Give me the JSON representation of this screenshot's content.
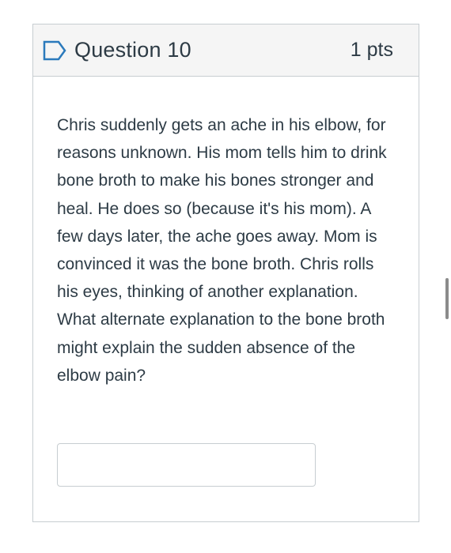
{
  "question": {
    "title": "Question 10",
    "points": "1 pts",
    "text": "Chris suddenly gets an ache in his elbow, for reasons unknown. His mom tells him to drink bone broth to make his bones stronger and heal. He does so (because it's his mom). A few days later, the ache goes away. Mom is convinced it was the bone broth. Chris rolls his eyes, thinking of another explanation.  What alternate explanation to the bone broth might explain the sudden absence of the elbow pain?",
    "answer_value": "",
    "flag_icon": "bookmark-flag-icon"
  },
  "colors": {
    "text": "#2d3b45",
    "border": "#c7cdd1",
    "header_bg": "#f5f5f5",
    "flag_outline": "#2b7abc"
  }
}
